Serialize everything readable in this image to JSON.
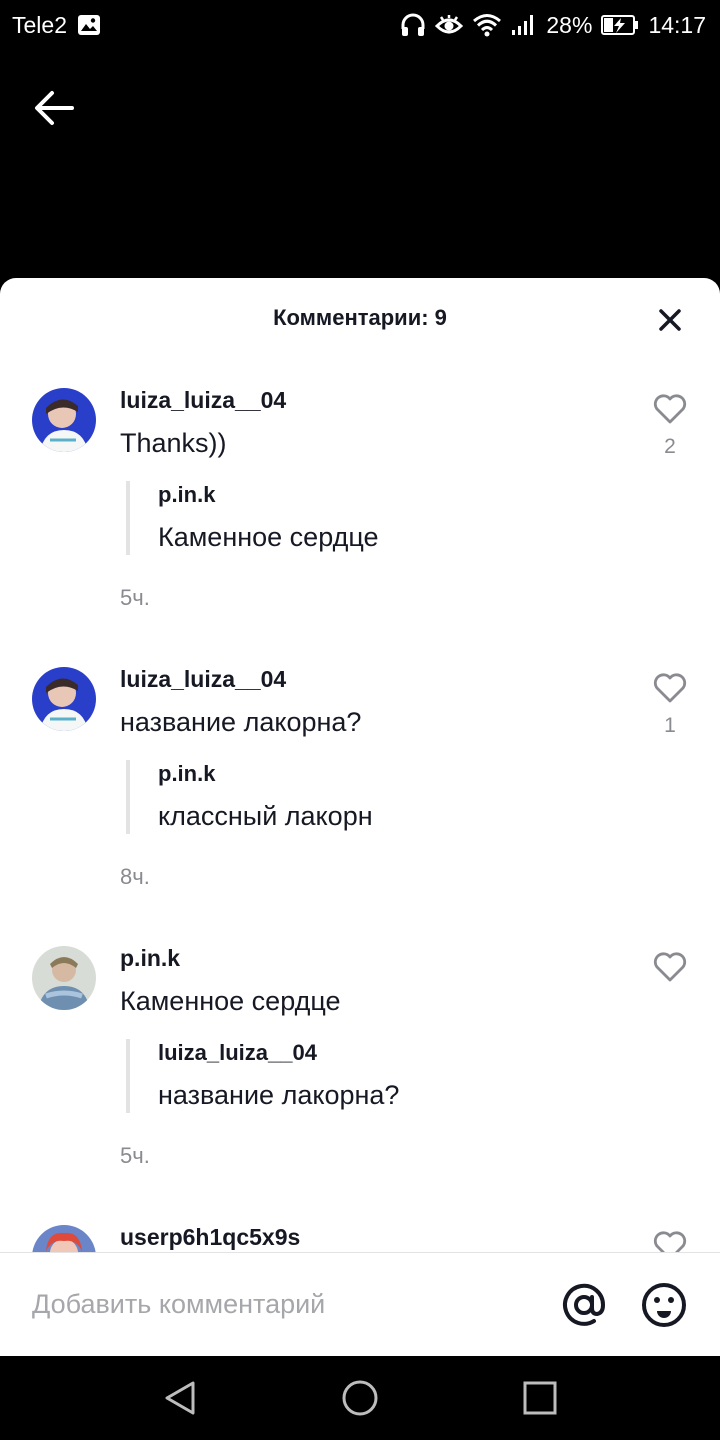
{
  "status_bar": {
    "carrier": "Tele2",
    "battery": "28%",
    "time": "14:17"
  },
  "header": {
    "title": "Комментарии: 9"
  },
  "comments": [
    {
      "username": "luiza_luiza__04",
      "text": "Thanks))",
      "likes": "2",
      "reply": {
        "username": "p.in.k",
        "text": "Каменное сердце"
      },
      "time": "5ч."
    },
    {
      "username": "luiza_luiza__04",
      "text": "название лакорна?",
      "likes": "1",
      "reply": {
        "username": "p.in.k",
        "text": "классный лакорн"
      },
      "time": "8ч."
    },
    {
      "username": "p.in.k",
      "text": "Каменное сердце",
      "likes": "",
      "reply": {
        "username": "luiza_luiza__04",
        "text": "название лакорна?"
      },
      "time": "5ч."
    },
    {
      "username": "userp6h1qc5x9s"
    }
  ],
  "input": {
    "placeholder": "Добавить комментарий"
  },
  "icons": {
    "back": "arrow-left-icon",
    "close": "close-icon",
    "like": "heart-outline-icon",
    "mention": "at-sign-icon",
    "emoji": "smiley-icon",
    "nav": [
      "back-triangle-icon",
      "home-circle-icon",
      "recents-square-icon"
    ]
  },
  "colors": {
    "text_primary": "#161823",
    "text_secondary": "#8a8b91",
    "placeholder": "#a6a7ab"
  }
}
